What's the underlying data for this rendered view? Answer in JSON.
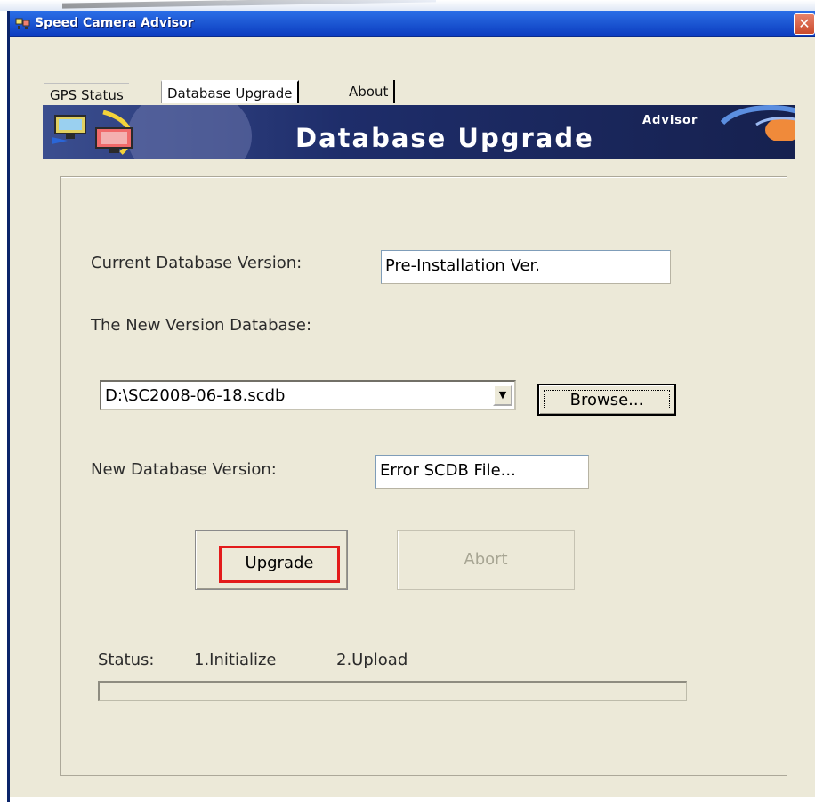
{
  "window": {
    "title": "Speed Camera Advisor",
    "close_glyph": "✕",
    "title_icon": "app-icon"
  },
  "tabs": [
    {
      "label": "GPS Status",
      "active": false
    },
    {
      "label": "Database Upgrade",
      "active": true
    },
    {
      "label": "About",
      "active": false
    }
  ],
  "banner": {
    "small": "Advisor",
    "title": "Database Upgrade"
  },
  "form": {
    "current_version_label": "Current Database Version:",
    "current_version_value": "Pre-Installation Ver.",
    "new_db_label": "The New Version Database:",
    "new_db_path": "D:\\SC2008-06-18.scdb",
    "combo_arrow": "▼",
    "browse_label": "Browse...",
    "new_version_label": "New Database Version:",
    "new_version_value": "Error SCDB File..."
  },
  "actions": {
    "upgrade_label": "Upgrade",
    "abort_label": "Abort"
  },
  "status": {
    "label": "Status:",
    "step1": "1.Initialize",
    "step2": "2.Upload",
    "progress": 0
  },
  "colors": {
    "titlebar": "#1f5bd6",
    "window_bg": "#ece9d8",
    "highlight": "#e31b1b",
    "banner": "#1e2d6a"
  }
}
